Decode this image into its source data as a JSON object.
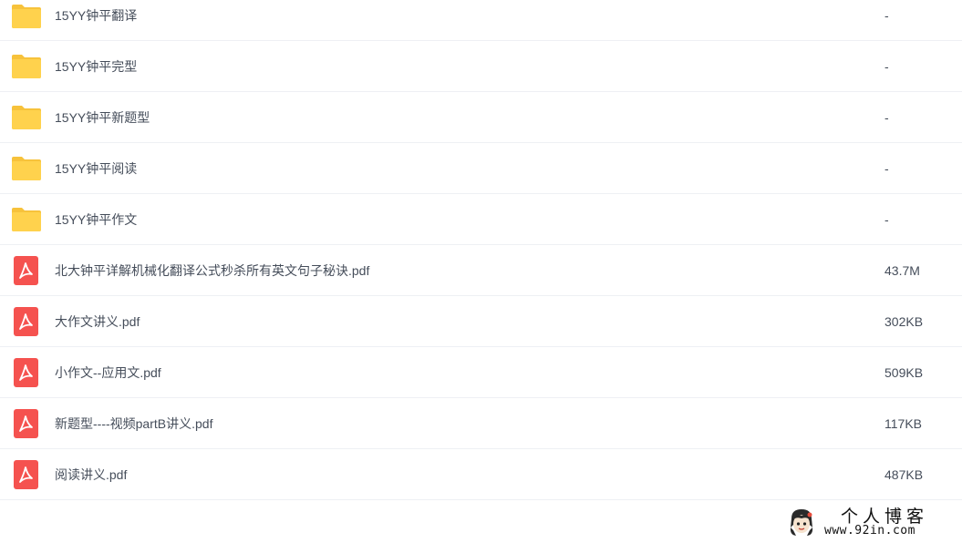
{
  "files": [
    {
      "name": "15YY钟平翻译",
      "size": "-",
      "type": "folder",
      "icon": "folder-icon"
    },
    {
      "name": "15YY钟平完型",
      "size": "-",
      "type": "folder",
      "icon": "folder-icon"
    },
    {
      "name": "15YY钟平新题型",
      "size": "-",
      "type": "folder",
      "icon": "folder-icon"
    },
    {
      "name": "15YY钟平阅读",
      "size": "-",
      "type": "folder",
      "icon": "folder-icon"
    },
    {
      "name": "15YY钟平作文",
      "size": "-",
      "type": "folder",
      "icon": "folder-icon"
    },
    {
      "name": "北大钟平详解机械化翻译公式秒杀所有英文句子秘诀.pdf",
      "size": "43.7M",
      "type": "pdf",
      "icon": "pdf-icon"
    },
    {
      "name": "大作文讲义.pdf",
      "size": "302KB",
      "type": "pdf",
      "icon": "pdf-icon"
    },
    {
      "name": "小作文--应用文.pdf",
      "size": "509KB",
      "type": "pdf",
      "icon": "pdf-icon"
    },
    {
      "name": "新题型----视频partB讲义.pdf",
      "size": "117KB",
      "type": "pdf",
      "icon": "pdf-icon"
    },
    {
      "name": "阅读讲义.pdf",
      "size": "487KB",
      "type": "pdf",
      "icon": "pdf-icon"
    }
  ],
  "watermark": {
    "title": "个人博客",
    "url": "www.92in.com"
  },
  "colors": {
    "folder": "#ffd24d",
    "folder_tab": "#f7c23b",
    "pdf": "#f5524f",
    "text": "#454d5a",
    "divider": "#eef0f4"
  }
}
